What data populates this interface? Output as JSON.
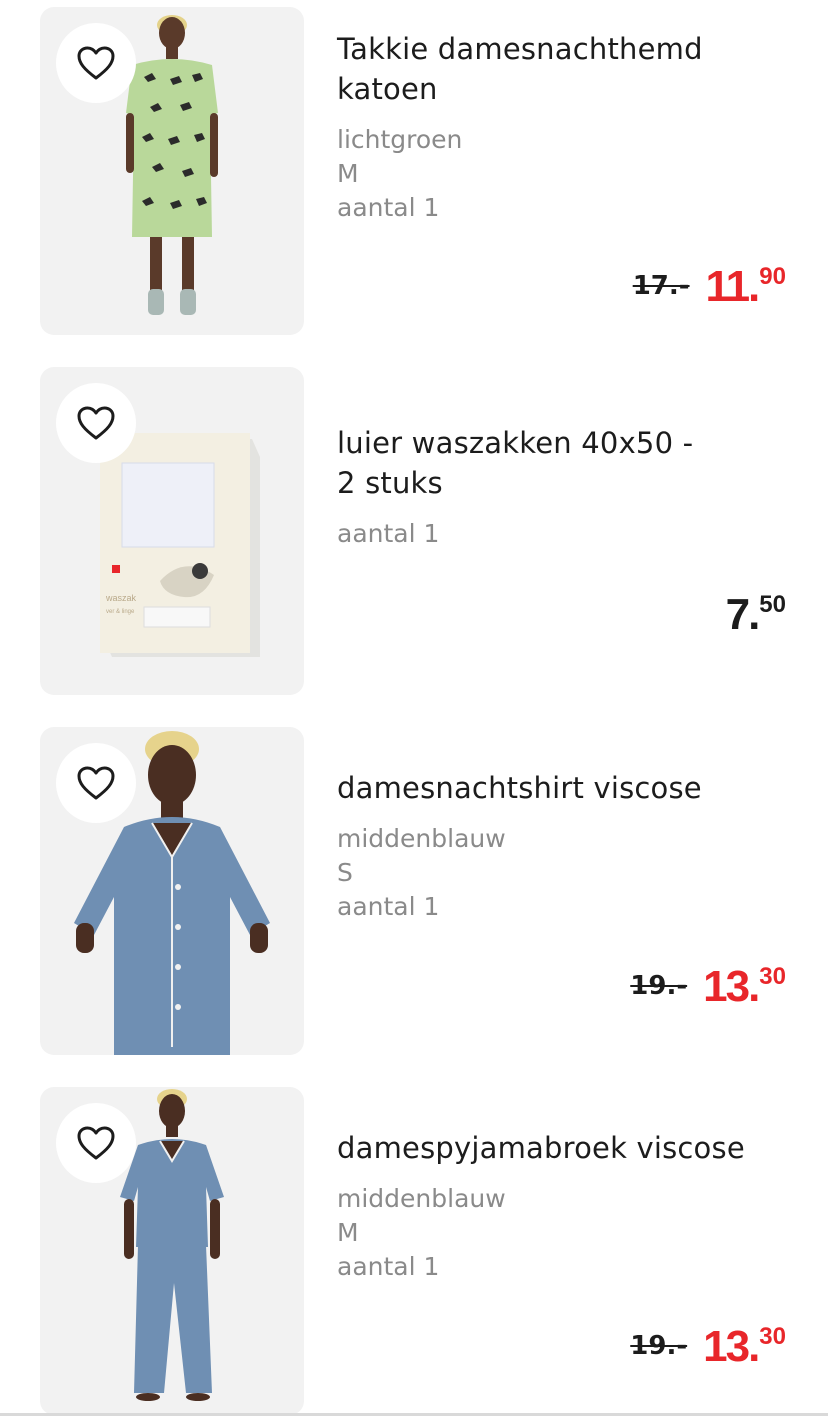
{
  "items": [
    {
      "name_line1": "Takkie damesnachthemd",
      "name_line2": "katoen",
      "color": "lichtgroen",
      "size": "M",
      "qty": "aantal 1",
      "old_price": "17.-",
      "price_whole": "11.",
      "price_cents": "90",
      "on_sale": true
    },
    {
      "name_line1": "luier waszakken 40x50 -",
      "name_line2": "2 stuks",
      "qty": "aantal 1",
      "price_whole": "7.",
      "price_cents": "50",
      "on_sale": false,
      "package_text": "waszak",
      "package_subtext": "ver & linge"
    },
    {
      "name_line1": "damesnachtshirt viscose",
      "color": "middenblauw",
      "size": "S",
      "qty": "aantal 1",
      "old_price": "19.-",
      "price_whole": "13.",
      "price_cents": "30",
      "on_sale": true
    },
    {
      "name_line1": "damespyjamabroek viscose",
      "color": "middenblauw",
      "size": "M",
      "qty": "aantal 1",
      "old_price": "19.-",
      "price_whole": "13.",
      "price_cents": "30",
      "on_sale": true
    }
  ],
  "colors": {
    "sale_red": "#e8262a",
    "text_dark": "#1c1c1c",
    "text_grey": "#8a8a8a",
    "thumb_bg": "#f2f2f2"
  },
  "icons": {
    "favorite": "heart-outline-icon"
  }
}
